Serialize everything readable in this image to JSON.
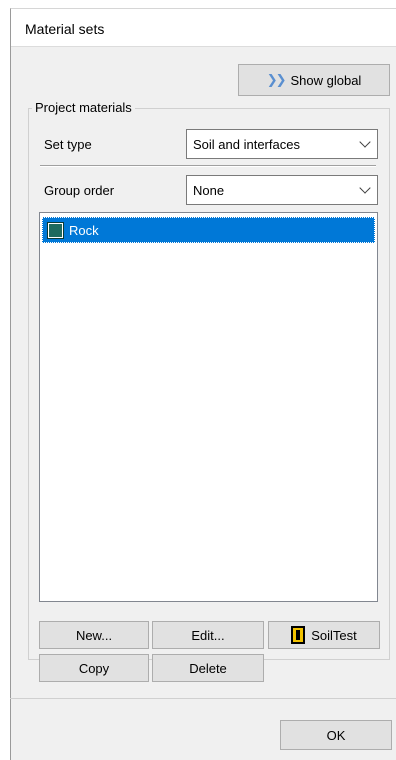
{
  "window": {
    "title": "Material sets"
  },
  "toolbar": {
    "show_global_label": "Show global",
    "show_global_icon": "double-chevron-right-icon"
  },
  "project_materials": {
    "legend": "Project materials",
    "set_type": {
      "label": "Set type",
      "value": "Soil and interfaces"
    },
    "group_order": {
      "label": "Group order",
      "value": "None"
    },
    "list": [
      {
        "name": "Rock",
        "color": "#1e6a5e",
        "selected": true
      }
    ]
  },
  "buttons": {
    "new": "New...",
    "edit": "Edit...",
    "soiltest": "SoilTest",
    "copy": "Copy",
    "delete": "Delete",
    "ok": "OK"
  },
  "colors": {
    "selection": "#0078d7",
    "material_rock": "#1e6a5e"
  }
}
